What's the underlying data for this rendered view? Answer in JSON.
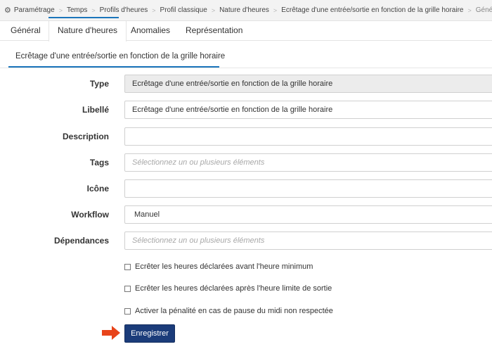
{
  "breadcrumb": {
    "items": [
      {
        "label": "Paramétrage"
      },
      {
        "label": "Temps"
      },
      {
        "label": "Profils d'heures"
      },
      {
        "label": "Profil classique"
      },
      {
        "label": "Nature d'heures"
      },
      {
        "label": "Ecrêtage d'une entrée/sortie en fonction de la grille horaire"
      },
      {
        "label": "Général"
      }
    ]
  },
  "tabs": [
    {
      "label": "Général"
    },
    {
      "label": "Nature d'heures"
    },
    {
      "label": "Anomalies"
    },
    {
      "label": "Représentation"
    }
  ],
  "subtab": {
    "label": "Ecrêtage d'une entrée/sortie en fonction de la grille horaire"
  },
  "form": {
    "type": {
      "label": "Type",
      "value": "Ecrêtage d'une entrée/sortie en fonction de la grille horaire"
    },
    "libelle": {
      "label": "Libellé",
      "value": "Ecrêtage d'une entrée/sortie en fonction de la grille horaire"
    },
    "description": {
      "label": "Description",
      "value": ""
    },
    "tags": {
      "label": "Tags",
      "placeholder": "Sélectionnez un ou plusieurs éléments"
    },
    "icone": {
      "label": "Icône",
      "value": ""
    },
    "workflow": {
      "label": "Workflow",
      "value": "Manuel"
    },
    "dependances": {
      "label": "Dépendances",
      "placeholder": "Sélectionnez un ou plusieurs éléments"
    }
  },
  "checkboxes": [
    {
      "label": "Ecrêter les heures déclarées avant l'heure minimum",
      "checked": false
    },
    {
      "label": "Ecrêter les heures déclarées après l'heure limite de sortie",
      "checked": false
    },
    {
      "label": "Activer la pénalité en cas de pause du midi non respectée",
      "checked": false
    }
  ],
  "buttons": {
    "save": "Enregistrer"
  },
  "colors": {
    "accent": "#1b75bb",
    "button": "#1b3c7a",
    "arrow": "#e8441a"
  }
}
